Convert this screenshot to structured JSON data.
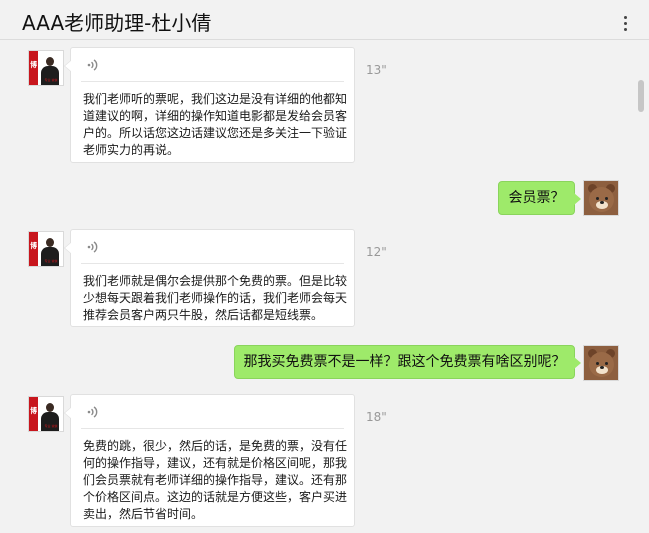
{
  "header": {
    "title": "AAA老师助理-杜小倩",
    "menu_icon": "more-vertical-icon"
  },
  "messages": [
    {
      "sender": "teacher",
      "type": "voice",
      "duration": "13\"",
      "lines": [
        "我们老师听的票呢，我们这边是没有详细的他都知",
        "道建议的啊，详细的操作知道电影都是发给会员客",
        "户的。所以话您这边话建议您还是多关注一下验证",
        "老师实力的再说。"
      ]
    },
    {
      "sender": "me",
      "type": "text",
      "text": "会员票？"
    },
    {
      "sender": "teacher",
      "type": "voice",
      "duration": "12\"",
      "lines": [
        "我们老师就是偶尔会提供那个免费的票。但是比较",
        "少想每天跟着我们老师操作的话，我们老师会每天",
        "推荐会员客户两只牛股，然后话都是短线票。"
      ]
    },
    {
      "sender": "me",
      "type": "text",
      "text": "那我买免费票不是一样？跟这个免费票有啥区别呢？"
    },
    {
      "sender": "teacher",
      "type": "voice",
      "duration": "18\"",
      "lines": [
        "免费的跳，很少，然后的话，是免费的票，没有任",
        "何的操作指导，建议，还有就是价格区间呢，那我",
        "们会员票就有老师详细的操作指导，建议。还有那",
        "个价格区间点。这边的话就是方便这些，客户买进",
        "卖出，然后节省时间。"
      ]
    }
  ],
  "avatars": {
    "teacher_logo": "博",
    "teacher_caption": "专业·诚信",
    "me_icon": "brown-bear-avatar-icon"
  },
  "colors": {
    "my_bubble": "#9eea6a",
    "teacher_red": "#c8161d",
    "background": "#f2f2f2"
  }
}
